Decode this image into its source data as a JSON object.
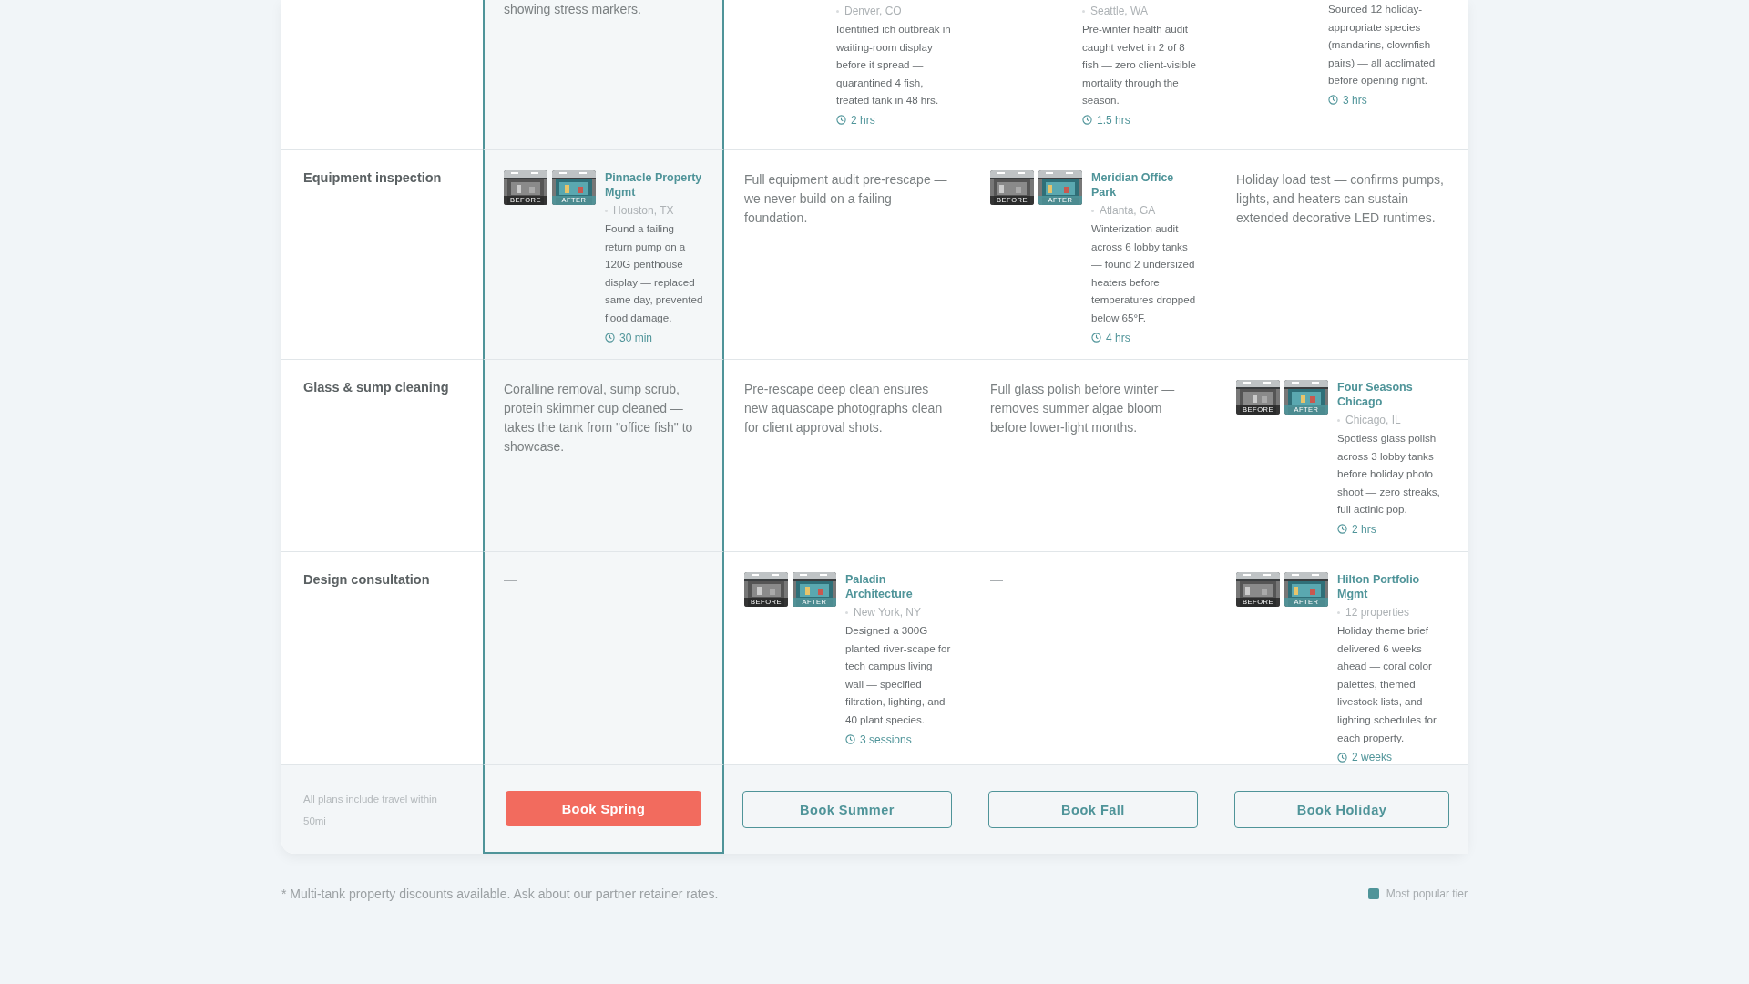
{
  "tiers": [
    {
      "featured": true
    },
    {
      "featured": false
    },
    {
      "featured": false
    },
    {
      "featured": false
    }
  ],
  "rows": [
    {
      "label": "",
      "cells": [
        {
          "kind": "text",
          "text": "showing stress markers."
        },
        {
          "kind": "case",
          "location": "Denver, CO",
          "description": "Identified ich outbreak in waiting-room display before it spread — quarantined 4 fish, treated tank in 48 hrs.",
          "time": "2 hrs"
        },
        {
          "kind": "case",
          "location": "Seattle, WA",
          "description": "Pre-winter health audit caught velvet in 2 of 8 fish — zero client-visible mortality through the season.",
          "time": "1.5 hrs"
        },
        {
          "kind": "case",
          "description": "Sourced 12 holiday-appropriate species (mandarins, clownfish pairs) — all acclimated before opening night.",
          "time": "3 hrs"
        }
      ]
    },
    {
      "label": "Equipment inspection",
      "cells": [
        {
          "kind": "case",
          "before": "BEFORE",
          "after": "AFTER",
          "client": "Pinnacle Property Mgmt",
          "location": "Houston, TX",
          "description": "Found a failing return pump on a 120G penthouse display — replaced same day, prevented flood damage.",
          "time": "30 min"
        },
        {
          "kind": "text",
          "text": "Full equipment audit pre-rescape — we never build on a failing foundation."
        },
        {
          "kind": "case",
          "before": "BEFORE",
          "after": "AFTER",
          "client": "Meridian Office Park",
          "location": "Atlanta, GA",
          "description": "Winterization audit across 6 lobby tanks — found 2 undersized heaters before temperatures dropped below 65°F.",
          "time": "4 hrs"
        },
        {
          "kind": "text",
          "text": "Holiday load test — confirms pumps, lights, and heaters can sustain extended decorative LED runtimes."
        }
      ]
    },
    {
      "label": "Glass & sump cleaning",
      "cells": [
        {
          "kind": "text",
          "text": "Coralline removal, sump scrub, protein skimmer cup cleaned — takes the tank from \"office fish\" to showcase."
        },
        {
          "kind": "text",
          "text": "Pre-rescape deep clean ensures new aquascape photographs clean for client approval shots."
        },
        {
          "kind": "text",
          "text": "Full glass polish before winter — removes summer algae bloom before lower-light months."
        },
        {
          "kind": "case",
          "before": "BEFORE",
          "after": "AFTER",
          "client": "Four Seasons Chicago",
          "location": "Chicago, IL",
          "description": "Spotless glass polish across 3 lobby tanks before holiday photo shoot — zero streaks, full actinic pop.",
          "time": "2 hrs"
        }
      ]
    },
    {
      "label": "Design consultation",
      "cells": [
        {
          "kind": "empty",
          "text": "—"
        },
        {
          "kind": "case",
          "before": "BEFORE",
          "after": "AFTER",
          "client": "Paladin Architecture",
          "location": "New York, NY",
          "description": "Designed a 300G planted river-scape for tech campus living wall — specified filtration, lighting, and 40 plant species.",
          "time": "3 sessions"
        },
        {
          "kind": "empty",
          "text": "—"
        },
        {
          "kind": "case",
          "before": "BEFORE",
          "after": "AFTER",
          "client": "Hilton Portfolio Mgmt",
          "location": "12 properties",
          "description": "Holiday theme brief delivered 6 weeks ahead — coral color palettes, themed livestock lists, and lighting schedules for each property.",
          "time": "2 weeks"
        }
      ]
    }
  ],
  "footer": {
    "note": "All plans include travel within 50mi",
    "buttons": [
      {
        "label": "Book Spring",
        "primary": true
      },
      {
        "label": "Book Summer",
        "primary": false
      },
      {
        "label": "Book Fall",
        "primary": false
      },
      {
        "label": "Book Holiday",
        "primary": false
      }
    ]
  },
  "footnote": "* Multi-tank property discounts available. Ask about our partner retainer rates.",
  "legend": {
    "label": "Most popular tier",
    "color": "#4f9499"
  }
}
